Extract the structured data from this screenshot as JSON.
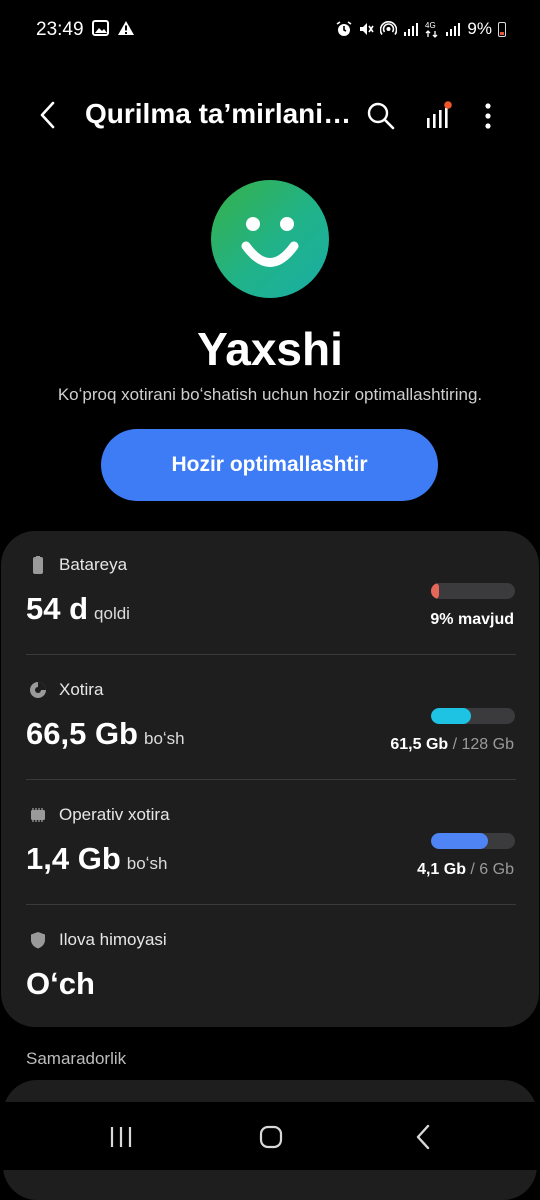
{
  "status_bar": {
    "time": "23:49",
    "left_icons": [
      "image-icon",
      "warning-icon"
    ],
    "right_icons": [
      "alarm-icon",
      "mute-icon",
      "hotspot-icon",
      "signal-icon",
      "4g-icon",
      "signal-icon-2"
    ],
    "battery_percent": "9%"
  },
  "appbar": {
    "title": "Qurilma taʼmirlanis...",
    "icons": [
      "back-icon",
      "search-icon",
      "stats-icon",
      "more-icon"
    ]
  },
  "hero": {
    "status": "Yaxshi",
    "subtitle": "Koʻproq xotirani boʻshatish uchun hozir optimallashtiring.",
    "button_label": "Hozir optimallashtir"
  },
  "rows": [
    {
      "label": "Batareya",
      "value": "54 d",
      "unit": "qoldi",
      "meta_main": "9% mavjud",
      "meta_muted": "",
      "level": 0.09,
      "color": "#e4675a",
      "icon": "battery-icon"
    },
    {
      "label": "Xotira",
      "value": "66,5 Gb",
      "unit": "boʻsh",
      "meta_main": "61,5 Gb",
      "meta_muted": " / 128 Gb",
      "level": 0.48,
      "color": "#1ec2e3",
      "icon": "storage-icon"
    },
    {
      "label": "Operativ xotira",
      "value": "1,4 Gb",
      "unit": "boʻsh",
      "meta_main": "4,1 Gb",
      "meta_muted": " / 6 Gb",
      "level": 0.68,
      "color": "#4f84f4",
      "icon": "memory-icon"
    },
    {
      "label": "Ilova himoyasi",
      "value": "Oʻch",
      "unit": "",
      "icon": "shield-icon"
    }
  ],
  "section": {
    "label": "Samaradorlik"
  },
  "nav": {
    "icons": [
      "recents-icon",
      "home-icon",
      "back-nav-icon"
    ]
  }
}
